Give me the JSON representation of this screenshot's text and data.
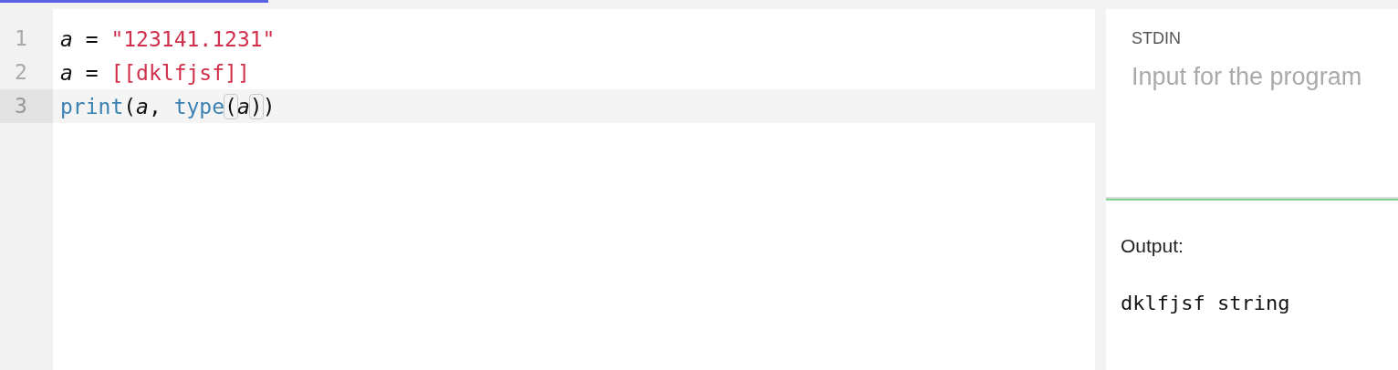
{
  "progress": {
    "level": 0.245
  },
  "editor": {
    "lines": [
      {
        "number": "1",
        "selected": false,
        "tokens": [
          {
            "kind": "variable",
            "text": "a"
          },
          {
            "kind": "plain",
            "text": " = "
          },
          {
            "kind": "string",
            "text": "\"123141.1231\""
          }
        ]
      },
      {
        "number": "2",
        "selected": false,
        "tokens": [
          {
            "kind": "variable",
            "text": "a"
          },
          {
            "kind": "plain",
            "text": " = "
          },
          {
            "kind": "string",
            "text": "[[dklfjsf]]"
          }
        ]
      },
      {
        "number": "3",
        "selected": true,
        "tokens": [
          {
            "kind": "builtin",
            "text": "print"
          },
          {
            "kind": "plain",
            "text": "("
          },
          {
            "kind": "variable",
            "text": "a"
          },
          {
            "kind": "plain",
            "text": ", "
          },
          {
            "kind": "builtin",
            "text": "type"
          },
          {
            "kind": "bracket",
            "text": "("
          },
          {
            "kind": "variable",
            "text": "a"
          },
          {
            "kind": "bracket",
            "text": ")"
          },
          {
            "kind": "plain",
            "text": ")"
          }
        ]
      }
    ]
  },
  "stdin": {
    "label": "STDIN",
    "placeholder": "Input for the program"
  },
  "output": {
    "label": "Output:",
    "text": "dklfjsf string"
  }
}
